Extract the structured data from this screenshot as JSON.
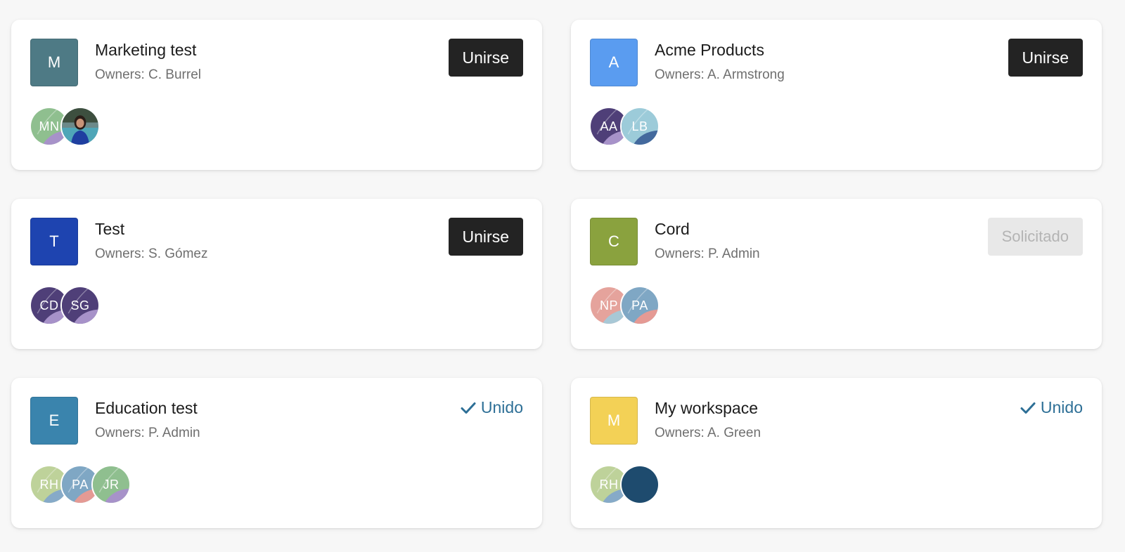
{
  "join_label": "Unirse",
  "requested_label": "Solicitado",
  "joined_label": "Unido",
  "colors": {
    "accent_joined": "#2d6f96",
    "join_button": "#232323"
  },
  "workspaces": [
    {
      "icon_letter": "M",
      "icon_color": "#4e7a85",
      "name": "Marketing test",
      "owners": "Owners: C. Burrel",
      "status": "join",
      "members": [
        {
          "initials": "MN",
          "c1": "#8fbf8f",
          "c2": "#a792c9"
        },
        {
          "initials": "",
          "photo": true
        }
      ]
    },
    {
      "icon_letter": "A",
      "icon_color": "#5a9cf0",
      "name": "Acme Products",
      "owners": "Owners: A. Armstrong",
      "status": "join",
      "members": [
        {
          "initials": "AA",
          "c1": "#4f3f78",
          "c2": "#a792c9"
        },
        {
          "initials": "LB",
          "c1": "#9ccbd9",
          "c2": "#43699d"
        }
      ]
    },
    {
      "icon_letter": "T",
      "icon_color": "#1e44b0",
      "name": "Test",
      "owners": "Owners: S. Gómez",
      "status": "join",
      "members": [
        {
          "initials": "CD",
          "c1": "#4f3f78",
          "c2": "#a792c9"
        },
        {
          "initials": "SG",
          "c1": "#4f3f78",
          "c2": "#a792c9"
        }
      ]
    },
    {
      "icon_letter": "C",
      "icon_color": "#8aa23e",
      "name": "Cord",
      "owners": "Owners: P. Admin",
      "status": "requested",
      "members": [
        {
          "initials": "NP",
          "c1": "#e5a39c",
          "c2": "#a8c8d6"
        },
        {
          "initials": "PA",
          "c1": "#7fa7c4",
          "c2": "#e59a94"
        }
      ]
    },
    {
      "icon_letter": "E",
      "icon_color": "#3a84ad",
      "name": "Education test",
      "owners": "Owners: P. Admin",
      "status": "joined",
      "members": [
        {
          "initials": "RH",
          "c1": "#bed29a",
          "c2": "#86aac8"
        },
        {
          "initials": "PA",
          "c1": "#7fa7c4",
          "c2": "#e59a94"
        },
        {
          "initials": "JR",
          "c1": "#8fbf8f",
          "c2": "#a792c9"
        }
      ]
    },
    {
      "icon_letter": "M",
      "icon_color": "#f3d156",
      "name": "My workspace",
      "owners": "Owners: A. Green",
      "status": "joined",
      "members": [
        {
          "initials": "RH",
          "c1": "#bed29a",
          "c2": "#86aac8"
        },
        {
          "initials": "",
          "solid": "#1e4b6e"
        }
      ]
    }
  ]
}
